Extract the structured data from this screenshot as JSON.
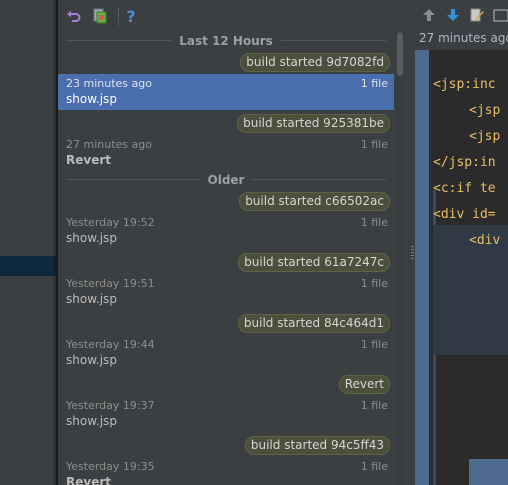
{
  "toolbar": {
    "revert_icon": "revert-icon",
    "create_patch_icon": "create-patch-icon",
    "help_icon": "help-icon"
  },
  "history": [
    {
      "kind": "header",
      "label": "Last 12 Hours"
    },
    {
      "kind": "tag",
      "label": "build started 9d7082fd"
    },
    {
      "kind": "entry",
      "time": "23 minutes ago",
      "files": "1 file",
      "name": "show.jsp",
      "selected": true,
      "bold": false
    },
    {
      "kind": "tag",
      "label": "build started 925381be"
    },
    {
      "kind": "entry",
      "time": "27 minutes ago",
      "files": "1 file",
      "name": "Revert",
      "selected": false,
      "bold": true
    },
    {
      "kind": "header",
      "label": "Older"
    },
    {
      "kind": "tag",
      "label": "build started c66502ac"
    },
    {
      "kind": "entry",
      "time": "Yesterday 19:52",
      "files": "1 file",
      "name": "show.jsp",
      "selected": false,
      "bold": false
    },
    {
      "kind": "tag",
      "label": "build started 61a7247c"
    },
    {
      "kind": "entry",
      "time": "Yesterday 19:51",
      "files": "1 file",
      "name": "show.jsp",
      "selected": false,
      "bold": false
    },
    {
      "kind": "tag",
      "label": "build started 84c464d1"
    },
    {
      "kind": "entry",
      "time": "Yesterday 19:44",
      "files": "1 file",
      "name": "show.jsp",
      "selected": false,
      "bold": false
    },
    {
      "kind": "tag",
      "label": "Revert"
    },
    {
      "kind": "entry",
      "time": "Yesterday 19:37",
      "files": "1 file",
      "name": "show.jsp",
      "selected": false,
      "bold": false
    },
    {
      "kind": "tag",
      "label": "build started 94c5ff43"
    },
    {
      "kind": "entry",
      "time": "Yesterday 19:35",
      "files": "1 file",
      "name": "Revert",
      "selected": false,
      "bold": true
    }
  ],
  "right_panel": {
    "timestamp": "27 minutes ago",
    "code_lines": [
      {
        "text": "<jsp:inc",
        "color": "#e8bf6a"
      },
      {
        "text": "<jsp",
        "color": "#e8bf6a"
      },
      {
        "text": "<jsp",
        "color": "#e8bf6a"
      },
      {
        "text": "</jsp:in",
        "color": "#e8bf6a"
      },
      {
        "text": "<c:if te",
        "color": "#e8bf6a"
      },
      {
        "text": "<div id=",
        "color": "#e8bf6a"
      },
      {
        "text": "<div",
        "color": "#e8bf6a"
      }
    ]
  },
  "colors": {
    "selection": "#4b6eaf",
    "tag_bg": "#4b4f3c",
    "accent_icon": "#589df6"
  }
}
